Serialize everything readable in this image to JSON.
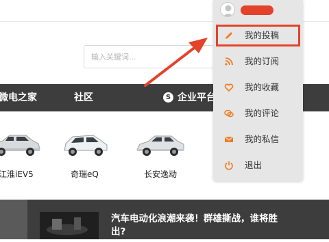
{
  "search": {
    "placeholder": "输入关键词..."
  },
  "nav": {
    "items": [
      "微电之家",
      "社区",
      "企业平台"
    ],
    "enterprise_icon": "S"
  },
  "cars": [
    {
      "name": "江淮iEV5",
      "color": "#d8dadc"
    },
    {
      "name": "奇瑞eQ",
      "color": "#eef0f2"
    },
    {
      "name": "长安逸动",
      "color": "#dfe1e3"
    }
  ],
  "news": {
    "title": "汽车电动化浪潮来袭！群雄撕战，谁将胜出?"
  },
  "dropdown": {
    "username_redaction_color": "#e3432b",
    "items": [
      {
        "label": "我的投稿",
        "icon": "pencil-icon",
        "highlighted": true
      },
      {
        "label": "我的订阅",
        "icon": "rss-icon"
      },
      {
        "label": "我的收藏",
        "icon": "heart-icon"
      },
      {
        "label": "我的评论",
        "icon": "comment-icon"
      },
      {
        "label": "我的私信",
        "icon": "mail-icon"
      },
      {
        "label": "退出",
        "icon": "power-icon"
      }
    ]
  },
  "colors": {
    "accent": "#f47a20",
    "highlight_box": "#e3432b",
    "navbar": "#3d3d3d",
    "dropdown_bg": "#e6e6e6"
  }
}
